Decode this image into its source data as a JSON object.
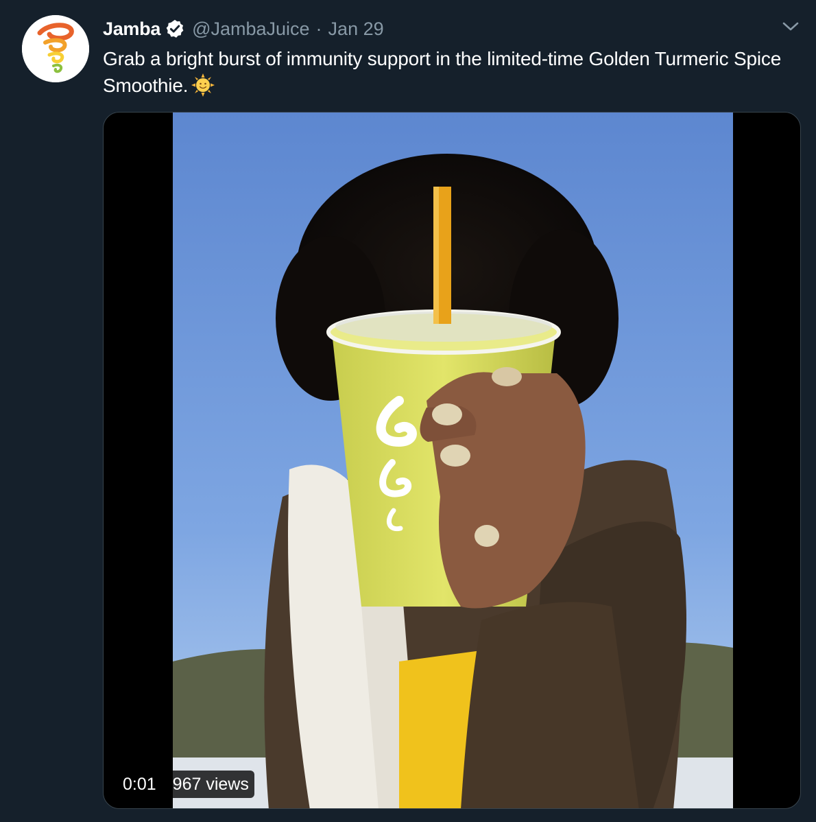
{
  "tweet": {
    "author_name": "Jamba",
    "handle": "@JambaJuice",
    "separator": "·",
    "date": "Jan 29",
    "text": "Grab a bright burst of immunity support in the limited-time Golden Turmeric Spice Smoothie.",
    "emoji": "sun-with-face-emoji"
  },
  "media": {
    "type": "video",
    "elapsed": "0:01",
    "views": "967 views"
  },
  "icons": {
    "avatar": "jamba-swirl-logo",
    "verified": "verified-badge-icon",
    "more": "chevron-down-icon"
  },
  "colors": {
    "background": "#15202b",
    "secondary_text": "#8899a6",
    "verified_fill": "#ffffff",
    "border": "#38444d",
    "smoothie": "#d8dc5c",
    "straw": "#e8a21a",
    "sky_top": "#5d87d0",
    "sky_bottom": "#a9c8ee"
  }
}
